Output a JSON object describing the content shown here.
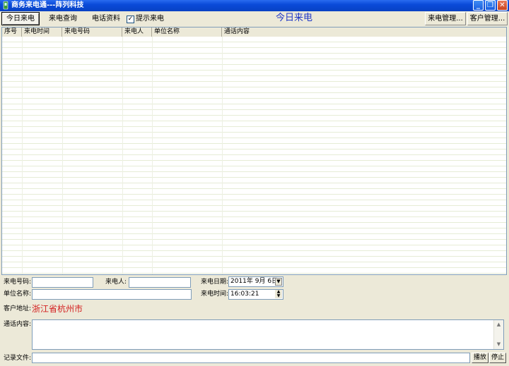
{
  "window": {
    "title": "商务来电通---阵列科技",
    "minimize": "_",
    "restore": "❐",
    "close": "✕"
  },
  "toolbar": {
    "today_calls": "今日来电",
    "call_query": "来电查询",
    "phone_directory": "电话资料",
    "show_calls_checkbox": "提示来电",
    "show_calls_checked": "✓",
    "banner": "今日来电",
    "call_management": "来电管理...",
    "customer_management": "客户管理..."
  },
  "table": {
    "columns": [
      "序号",
      "来电时间",
      "来电号码",
      "来电人",
      "单位名称",
      "通话内容"
    ],
    "rows": []
  },
  "form": {
    "caller_number_label": "来电号码:",
    "caller_number_value": "",
    "caller_name_label": "来电人:",
    "caller_name_value": "",
    "call_date_label": "来电日期:",
    "call_date_value": "2011年 9月 6日",
    "company_label": "单位名称:",
    "company_value": "",
    "call_time_label": "来电时间:",
    "call_time_value": "16:03:21",
    "address_label": "客户地址:",
    "address_value": "浙江省杭州市",
    "content_label": "通话内容:",
    "content_value": "",
    "record_label": "记录文件:",
    "record_value": "",
    "play_button": "播放",
    "stop_button": "停止"
  }
}
